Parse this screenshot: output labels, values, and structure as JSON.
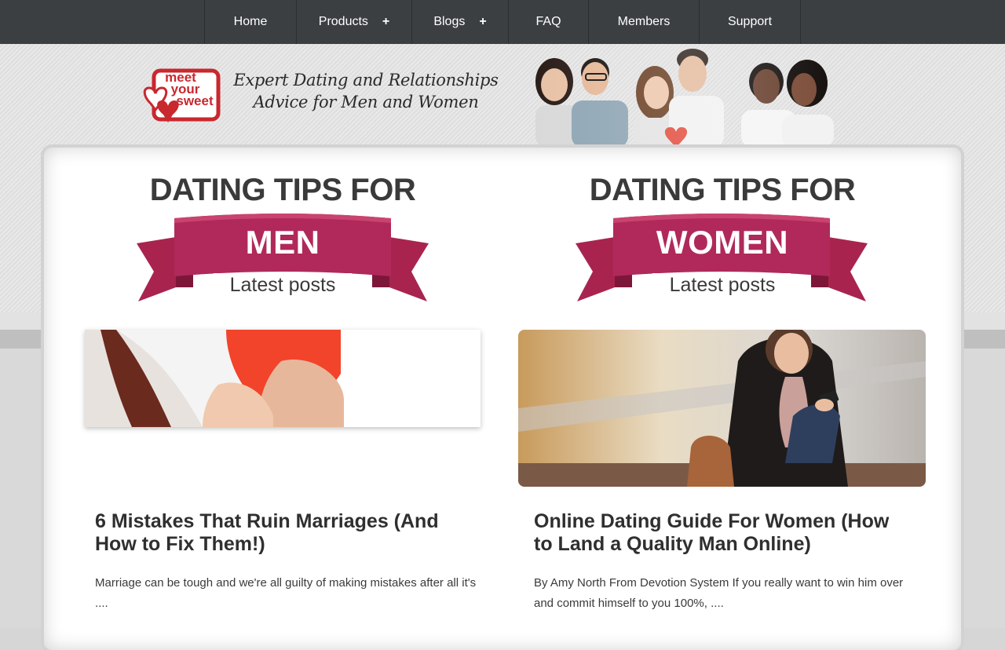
{
  "nav": {
    "items": [
      {
        "label": "Home",
        "has_submenu": false
      },
      {
        "label": "Products",
        "has_submenu": true
      },
      {
        "label": "Blogs",
        "has_submenu": true
      },
      {
        "label": "FAQ",
        "has_submenu": false
      },
      {
        "label": "Members",
        "has_submenu": false
      },
      {
        "label": "Support",
        "has_submenu": false
      }
    ],
    "submenu_icon": "+"
  },
  "header": {
    "logo": {
      "line1": "meet",
      "line2": "your",
      "line3": "sweet"
    },
    "tagline_line1": "Expert Dating and Relationships",
    "tagline_line2": "Advice for Men and Women"
  },
  "sections": {
    "men": {
      "heading": "DATING TIPS FOR",
      "ribbon": "MEN",
      "sublabel": "Latest posts",
      "post_title": "6 Mistakes That Ruin Marriages (And How to Fix Them!)",
      "post_excerpt": "Marriage can be tough and we're all guilty of making mistakes after all it's ...."
    },
    "women": {
      "heading": "DATING TIPS FOR",
      "ribbon": "WOMEN",
      "sublabel": "Latest posts",
      "post_title": "Online Dating Guide For Women (How to Land a Quality Man Online)",
      "post_excerpt": "By Amy North From Devotion System If you really want to win him over and commit himself to you 100%, ...."
    }
  },
  "colors": {
    "nav_bg": "#3c3f42",
    "ribbon": "#a8244f",
    "ribbon_dark": "#7d1739",
    "logo_red": "#c8282e",
    "heading_text": "#3a3a3a"
  }
}
